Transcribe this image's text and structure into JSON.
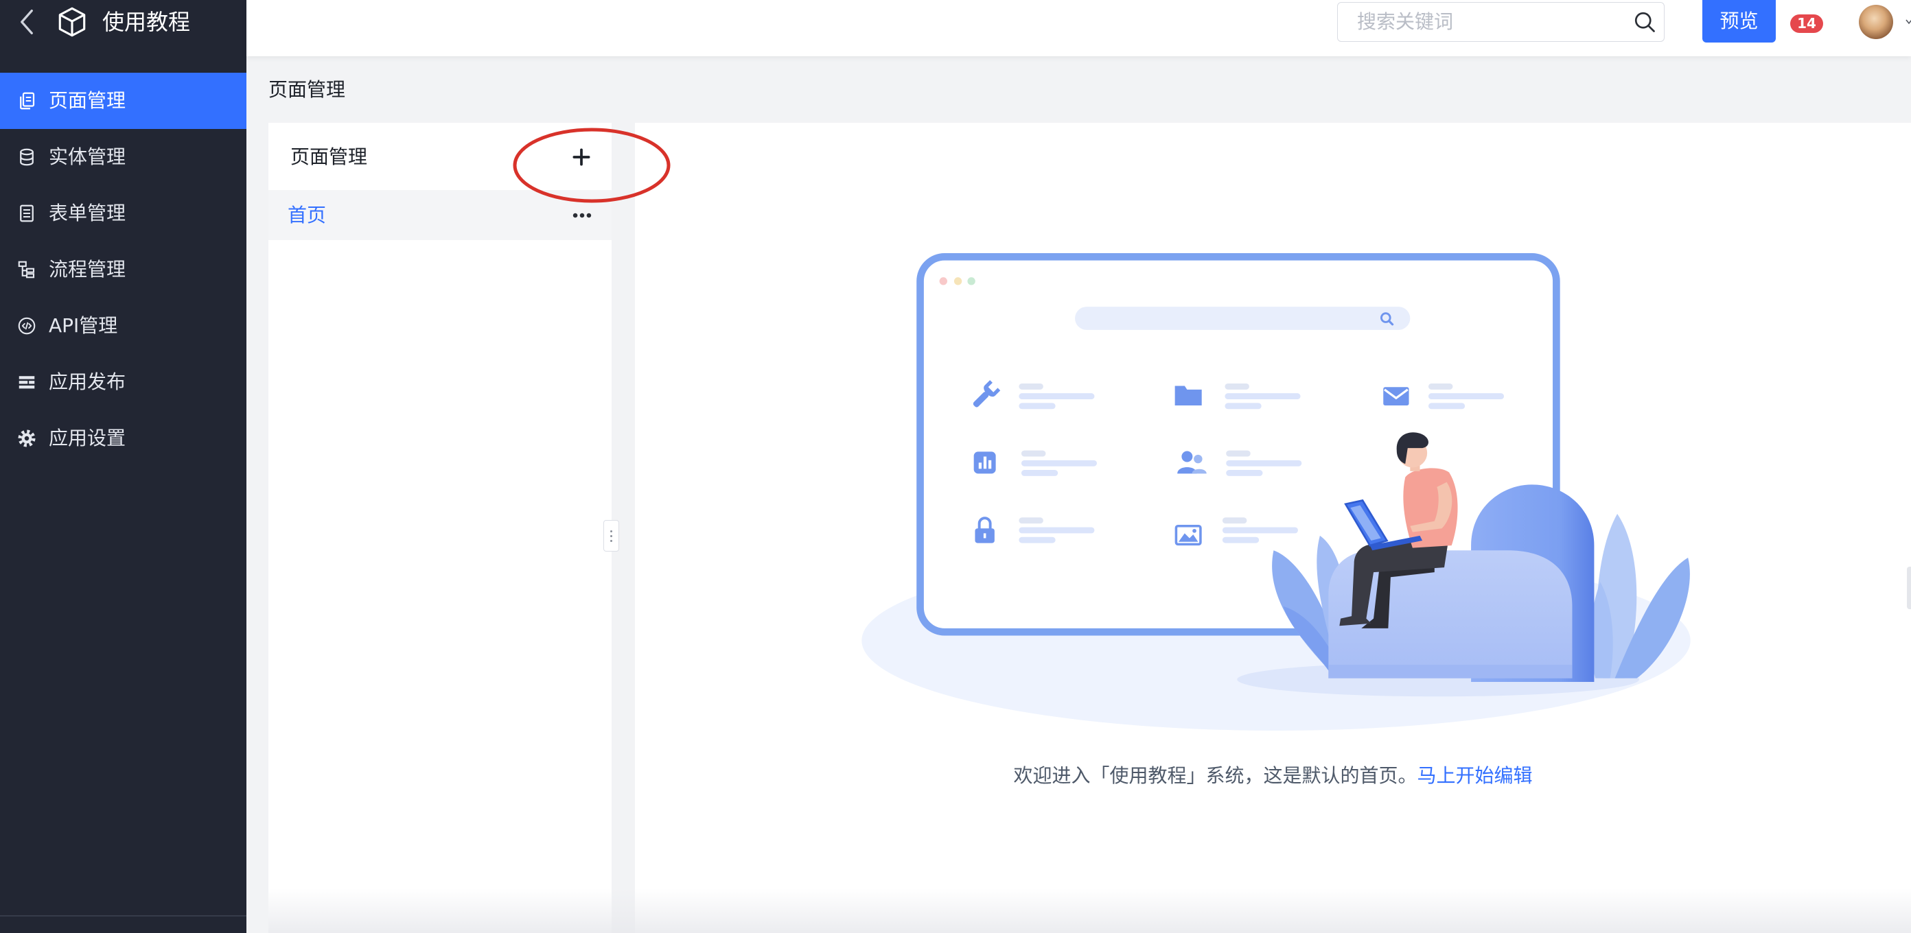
{
  "app": {
    "title": "使用教程",
    "back_icon": "chevron-left-icon",
    "logo_icon": "cube-icon"
  },
  "sidebar": {
    "items": [
      {
        "label": "页面管理",
        "icon": "pages-icon",
        "active": true
      },
      {
        "label": "实体管理",
        "icon": "database-icon",
        "active": false
      },
      {
        "label": "表单管理",
        "icon": "form-icon",
        "active": false
      },
      {
        "label": "流程管理",
        "icon": "flow-icon",
        "active": false
      },
      {
        "label": "API管理",
        "icon": "api-icon",
        "active": false
      },
      {
        "label": "应用发布",
        "icon": "publish-icon",
        "active": false
      },
      {
        "label": "应用设置",
        "icon": "gear-icon",
        "active": false
      }
    ]
  },
  "header": {
    "search": {
      "placeholder": "搜索关键词",
      "value": "",
      "icon": "search-icon"
    },
    "preview_label": "预览",
    "notification_count": "14",
    "avatar_icon": "avatar",
    "menu_icon": "chevron-down-icon"
  },
  "breadcrumb": {
    "title": "页面管理"
  },
  "page_panel": {
    "title": "页面管理",
    "add_icon": "plus-icon",
    "pages": [
      {
        "label": "首页",
        "active": true,
        "more_icon": "more-icon"
      }
    ]
  },
  "main": {
    "welcome_text": "欢迎进入「使用教程」系统，这是默认的首页。",
    "edit_link": "马上开始编辑"
  },
  "colors": {
    "accent": "#3370ff",
    "sidebar_bg": "#222633",
    "badge": "#e5484d",
    "annotation": "#d8322a"
  }
}
